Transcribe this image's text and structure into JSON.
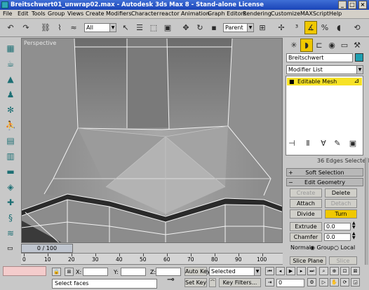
{
  "window": {
    "title": "Breitschwert01_unwrap02.max - Autodesk 3ds Max 8  - Stand-alone License",
    "min": "_",
    "max": "□",
    "close": "×"
  },
  "menu": [
    "File",
    "Edit",
    "Tools",
    "Group",
    "Views",
    "Create",
    "Modifiers",
    "Character",
    "reactor",
    "Animation",
    "Graph Editors",
    "Rendering",
    "Customize",
    "MAXScript",
    "Help"
  ],
  "toolbar": {
    "selection_filter": "All",
    "ref_coord": "Parent"
  },
  "viewport": {
    "label": "Perspective"
  },
  "command_panel": {
    "object_name": "Breitschwert",
    "object_color": "#1f9fb0",
    "modifier_list": "Modifier List",
    "stack_item": "Editable Mesh",
    "selection_status": "36 Edges Selected",
    "rollouts": {
      "soft_selection": "Soft Selection",
      "edit_geometry": "Edit Geometry"
    },
    "buttons": {
      "create": "Create",
      "delete": "Delete",
      "attach": "Attach",
      "detach": "Detach",
      "divide": "Divide",
      "turn": "Turn",
      "extrude": "Extrude",
      "chamfer": "Chamfer",
      "slice_plane": "Slice Plane",
      "slice": "Slice"
    },
    "extrude_value": "0.0",
    "chamfer_value": "0.0",
    "normal_label": "Normal:",
    "normal_group": "Group",
    "normal_local": "Local"
  },
  "timeline": {
    "slider": "0 / 100",
    "ticks": [
      "0",
      "10",
      "20",
      "30",
      "40",
      "50",
      "60",
      "70",
      "80",
      "90",
      "100"
    ]
  },
  "status": {
    "prompt": "Select faces",
    "x_label": "X:",
    "y_label": "Y:",
    "z_label": "Z:",
    "auto_key": "Auto Key",
    "set_key": "Set Key",
    "key_mode": "Selected",
    "key_filters": "Key Filters...",
    "frame": "0"
  }
}
